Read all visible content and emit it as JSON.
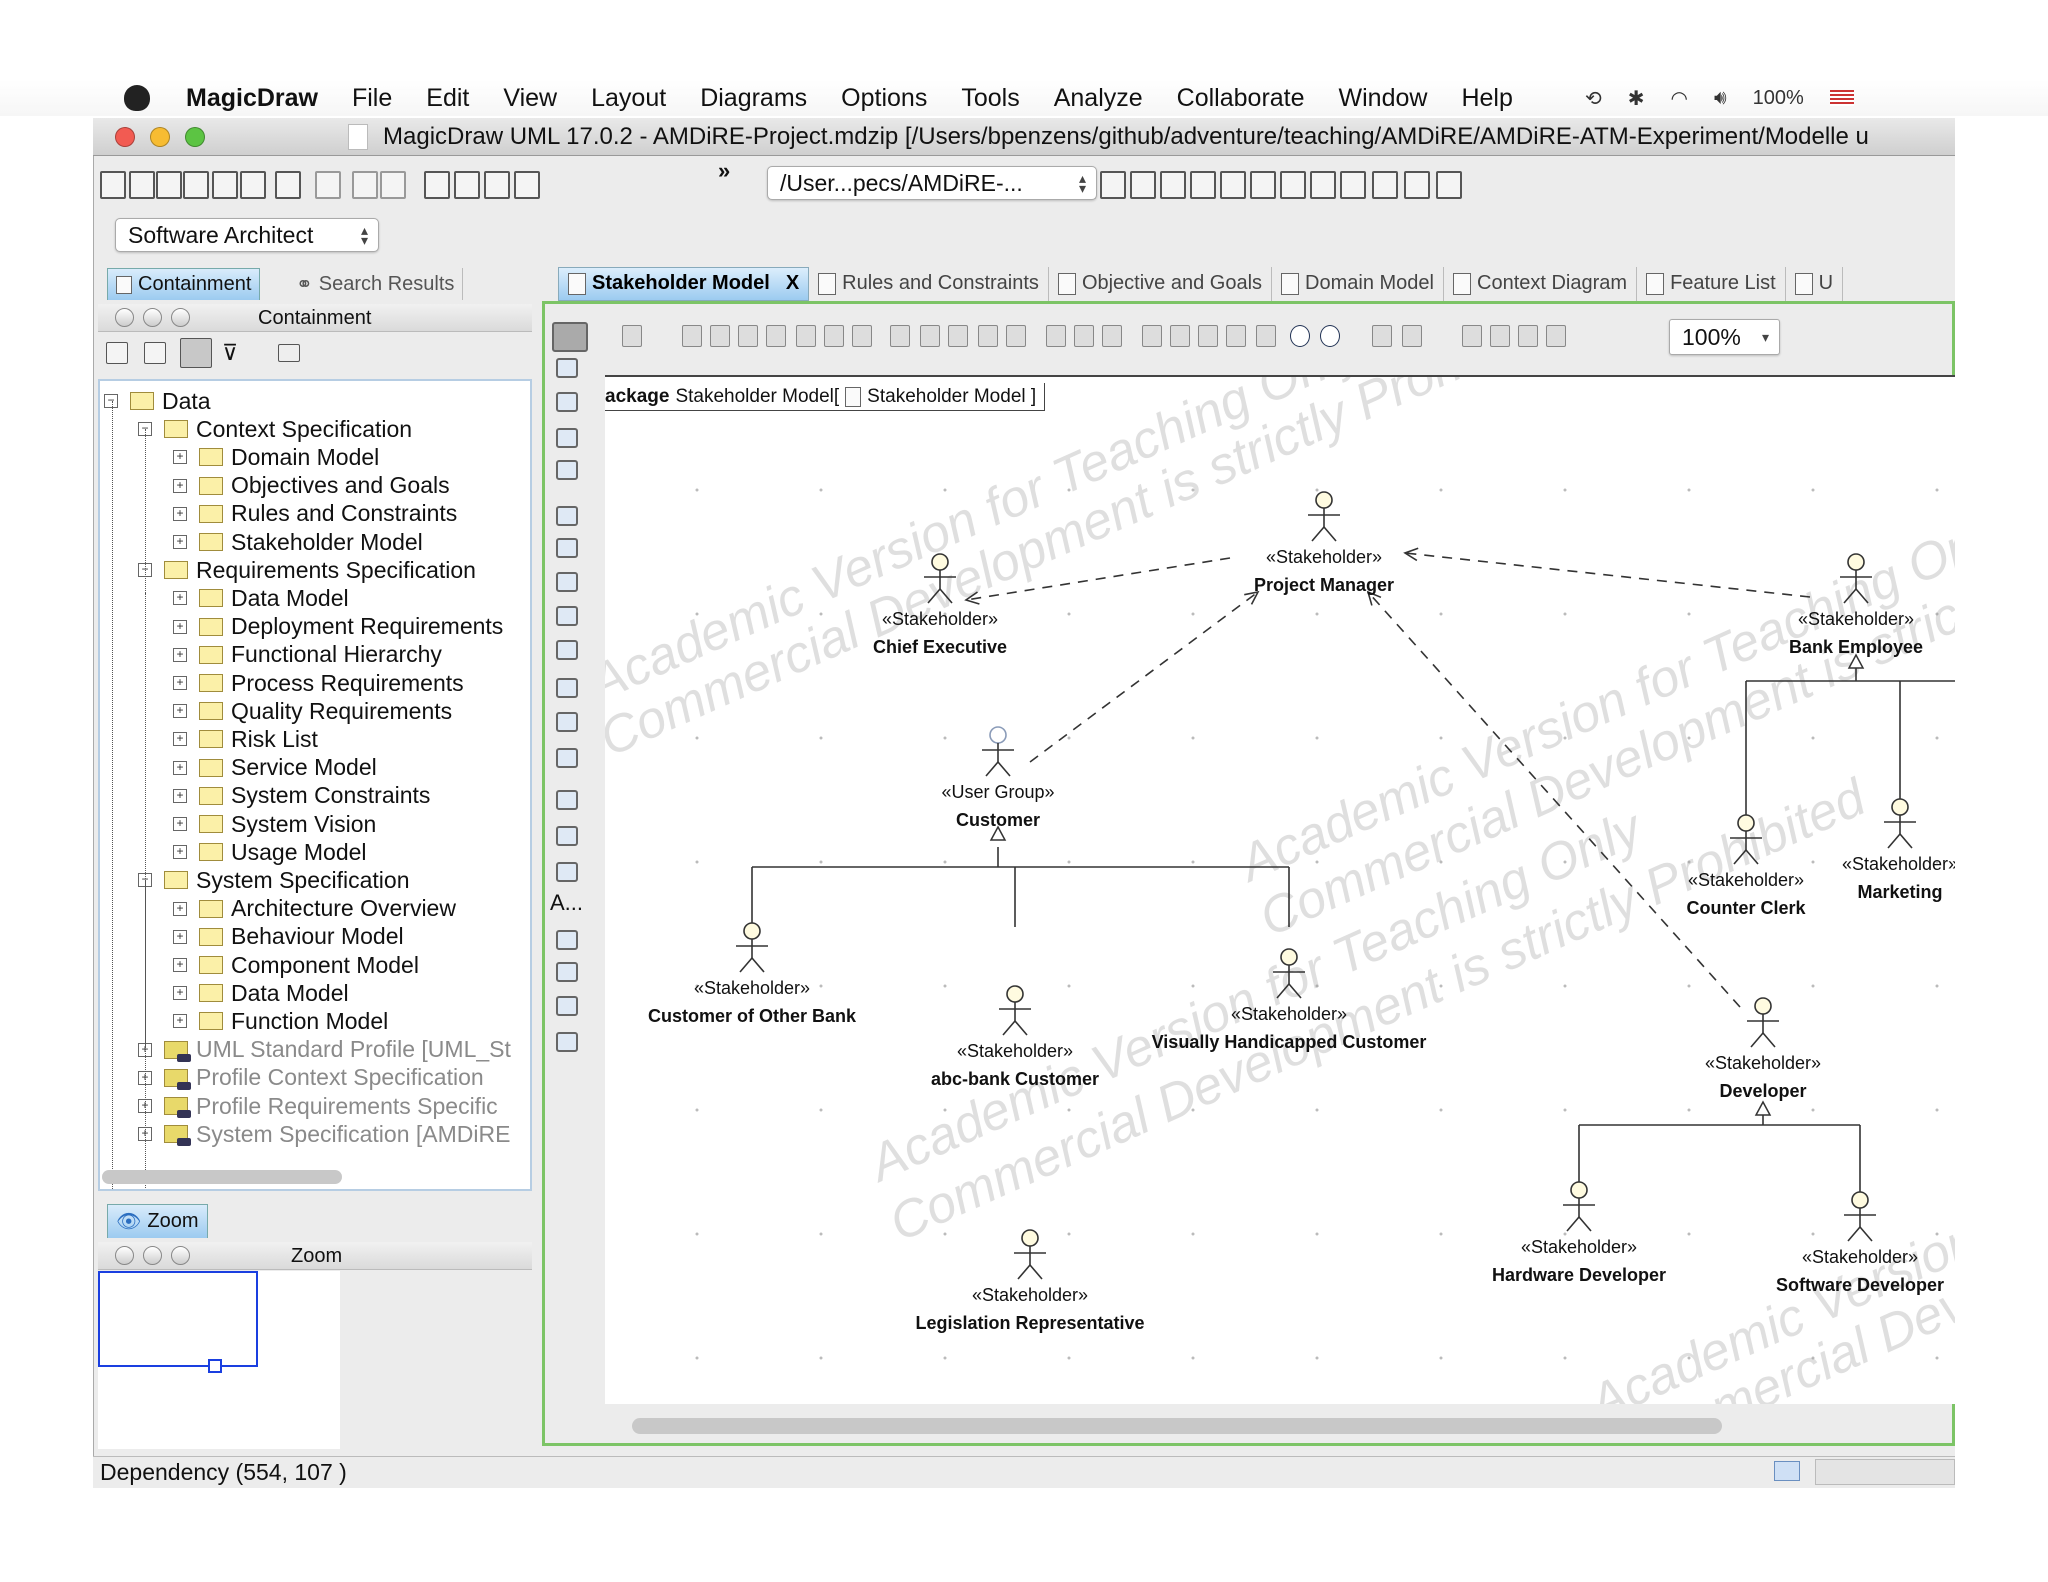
{
  "menubar": {
    "app": "MagicDraw",
    "items": [
      "File",
      "Edit",
      "View",
      "Layout",
      "Diagrams",
      "Options",
      "Tools",
      "Analyze",
      "Collaborate",
      "Window",
      "Help"
    ],
    "battery": "100%"
  },
  "window": {
    "title": "MagicDraw UML 17.0.2 - AMDiRE-Project.mdzip [/Users/bpenzens/github/adventure/teaching/AMDiRE/AMDiRE-ATM-Experiment/Modelle u"
  },
  "toolbar": {
    "path_combo": "/User...pecs/AMDiRE-...",
    "overflow": "»",
    "perspective": "Software Architect"
  },
  "left_panel": {
    "tabs": [
      "Containment",
      "Search Results"
    ],
    "header": "Containment",
    "tree": [
      {
        "label": "Data",
        "level": 0,
        "expanded": true
      },
      {
        "label": "Context Specification",
        "level": 1,
        "expanded": true
      },
      {
        "label": "Domain Model",
        "level": 2
      },
      {
        "label": "Objectives and Goals",
        "level": 2
      },
      {
        "label": "Rules and Constraints",
        "level": 2
      },
      {
        "label": "Stakeholder Model",
        "level": 2
      },
      {
        "label": "Requirements Specification",
        "level": 1,
        "expanded": true
      },
      {
        "label": "Data Model",
        "level": 2
      },
      {
        "label": "Deployment Requirements",
        "level": 2
      },
      {
        "label": "Functional Hierarchy",
        "level": 2
      },
      {
        "label": "Process Requirements",
        "level": 2
      },
      {
        "label": "Quality Requirements",
        "level": 2
      },
      {
        "label": "Risk List",
        "level": 2
      },
      {
        "label": "Service Model",
        "level": 2
      },
      {
        "label": "System Constraints",
        "level": 2
      },
      {
        "label": "System Vision",
        "level": 2
      },
      {
        "label": "Usage Model",
        "level": 2
      },
      {
        "label": "System Specification",
        "level": 1,
        "expanded": true
      },
      {
        "label": "Architecture Overview",
        "level": 2
      },
      {
        "label": "Behaviour Model",
        "level": 2
      },
      {
        "label": "Component Model",
        "level": 2
      },
      {
        "label": "Data Model",
        "level": 2
      },
      {
        "label": "Function Model",
        "level": 2
      },
      {
        "label": "UML Standard Profile [UML_St",
        "level": 1,
        "profile": true
      },
      {
        "label": "Profile Context Specification",
        "level": 1,
        "profile": true
      },
      {
        "label": "Profile Requirements Specific",
        "level": 1,
        "profile": true
      },
      {
        "label": "System Specification [AMDiRE",
        "level": 1,
        "profile": true
      }
    ]
  },
  "zoom_panel": {
    "tab": "Zoom",
    "header": "Zoom"
  },
  "diagram": {
    "tabs": [
      "Stakeholder Model",
      "Rules and Constraints",
      "Objective and Goals",
      "Domain Model",
      "Context Diagram",
      "Feature List",
      "U"
    ],
    "active_tab_close": "X",
    "zoom_level": "100%",
    "frame_keyword": "ackage",
    "frame_name": "Stakeholder Model[",
    "frame_diagram": "Stakeholder Model ]",
    "palette_text": "A...",
    "nodes": [
      {
        "stereotype": "«Stakeholder»",
        "name": "Project Manager"
      },
      {
        "stereotype": "«Stakeholder»",
        "name": "Chief Executive"
      },
      {
        "stereotype": "«Stakeholder»",
        "name": "Bank Employee"
      },
      {
        "stereotype": "«User Group»",
        "name": "Customer"
      },
      {
        "stereotype": "«Stakeholder»",
        "name": "Counter Clerk"
      },
      {
        "stereotype": "«Stakeholder»",
        "name": "Marketing"
      },
      {
        "stereotype": "«Stakeholder»",
        "name": "Customer of Other Bank"
      },
      {
        "stereotype": "«Stakeholder»",
        "name": "abc-bank Customer"
      },
      {
        "stereotype": "«Stakeholder»",
        "name": "Visually Handicapped Customer"
      },
      {
        "stereotype": "«Stakeholder»",
        "name": "Developer"
      },
      {
        "stereotype": "«Stakeholder»",
        "name": "Hardware Developer"
      },
      {
        "stereotype": "«Stakeholder»",
        "name": "Software Developer"
      },
      {
        "stereotype": "«Stakeholder»",
        "name": "Legislation Representative"
      }
    ],
    "watermark": [
      "Academic Version for Teaching Only",
      "Commercial Development is strictly Prohibited"
    ]
  },
  "status": {
    "text": "Dependency  (554, 107 )"
  },
  "colors": {
    "accent_green": "#7cc466",
    "tab_blue": "#9ccbf0",
    "zoom_frame": "#1a3fe0"
  }
}
